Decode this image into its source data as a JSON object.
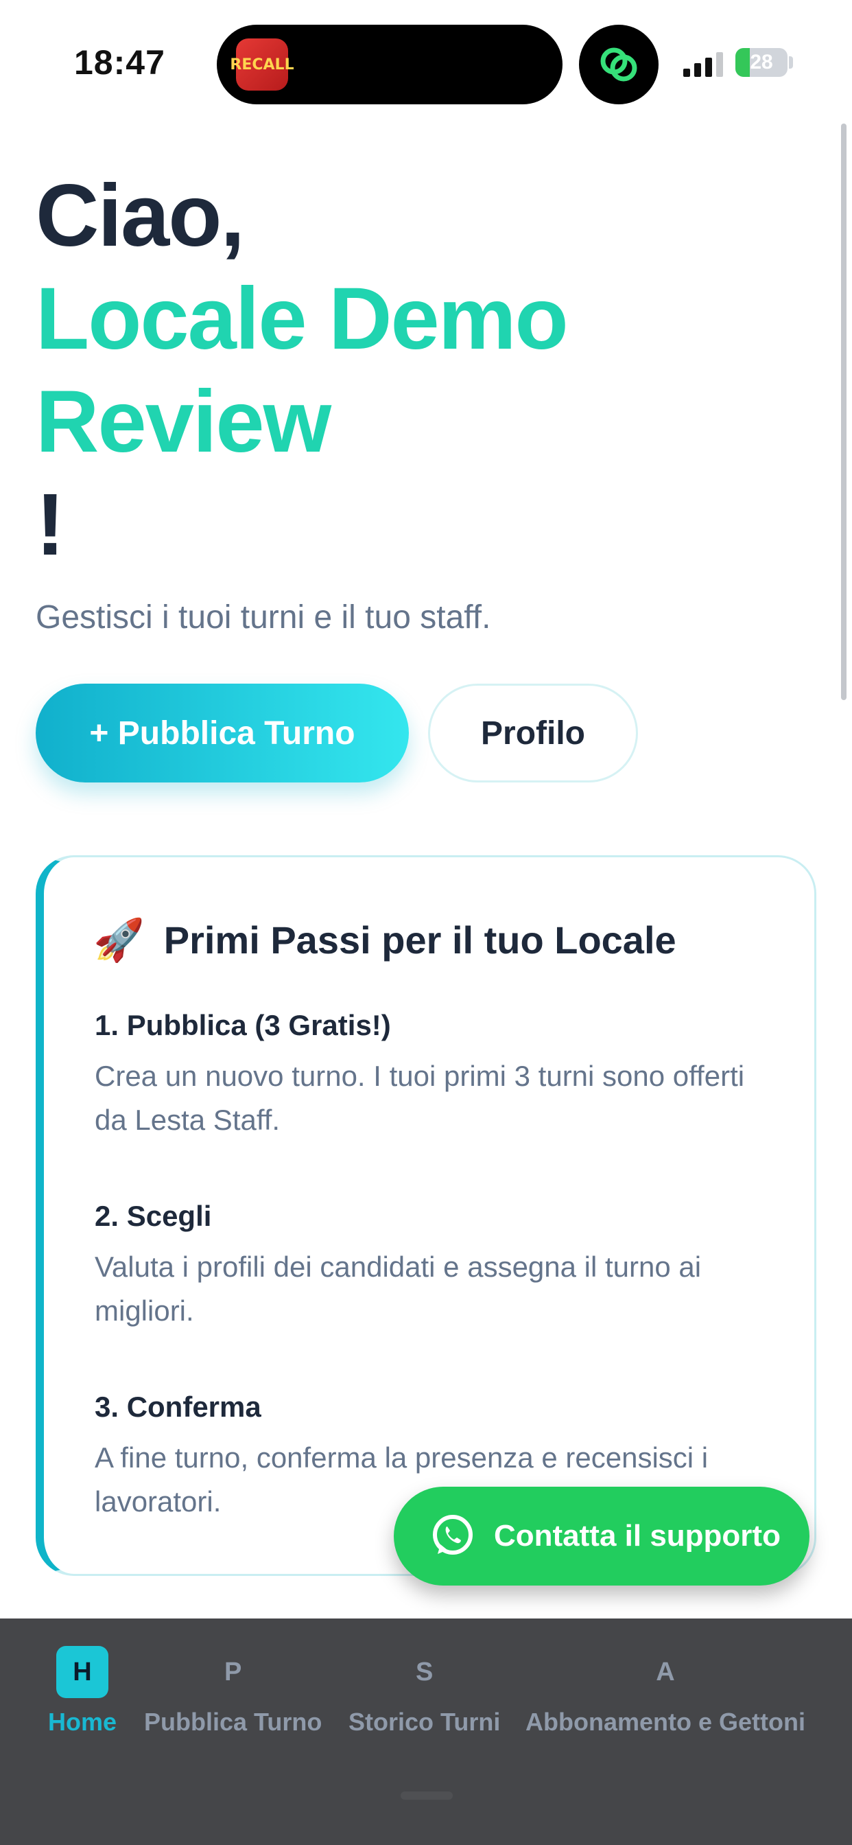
{
  "status": {
    "time": "18:47",
    "island_app_label": "RECALL",
    "battery": "28",
    "battery_level": 0.28
  },
  "hero": {
    "greeting": "Ciao,",
    "name_line1": "Locale Demo",
    "name_line2": "Review",
    "exclaim": "!",
    "subtitle": "Gestisci i tuoi turni e il tuo staff."
  },
  "actions": {
    "publish_label": "+ Pubblica Turno",
    "profile_label": "Profilo"
  },
  "card": {
    "icon": "rocket-icon",
    "rocket_glyph": "🚀",
    "title": "Primi Passi per il tuo Locale",
    "steps": [
      {
        "title": "1. Pubblica (3 Gratis!)",
        "desc": "Crea un nuovo turno. I tuoi primi 3 turni sono offerti da Lesta Staff."
      },
      {
        "title": "2. Scegli",
        "desc": "Valuta i profili dei candidati e assegna il turno ai migliori."
      },
      {
        "title": "3. Conferma",
        "desc": "A fine turno, conferma la presenza e recensisci i lavoratori."
      }
    ]
  },
  "support": {
    "label": "Contatta il supporto",
    "icon": "whatsapp-icon"
  },
  "nav": {
    "items": [
      {
        "letter": "H",
        "label": "Home",
        "active": true
      },
      {
        "letter": "P",
        "label": "Pubblica Turno"
      },
      {
        "letter": "S",
        "label": "Storico Turni"
      },
      {
        "letter": "A",
        "label": "Abbonamento e Gettoni"
      }
    ]
  },
  "colors": {
    "accent": "#20d4b0",
    "primary": "#11b0cc",
    "whatsapp": "#22cd5e",
    "nav_bg": "#454649",
    "text_dark": "#1e293b",
    "text_muted": "#64748b"
  }
}
